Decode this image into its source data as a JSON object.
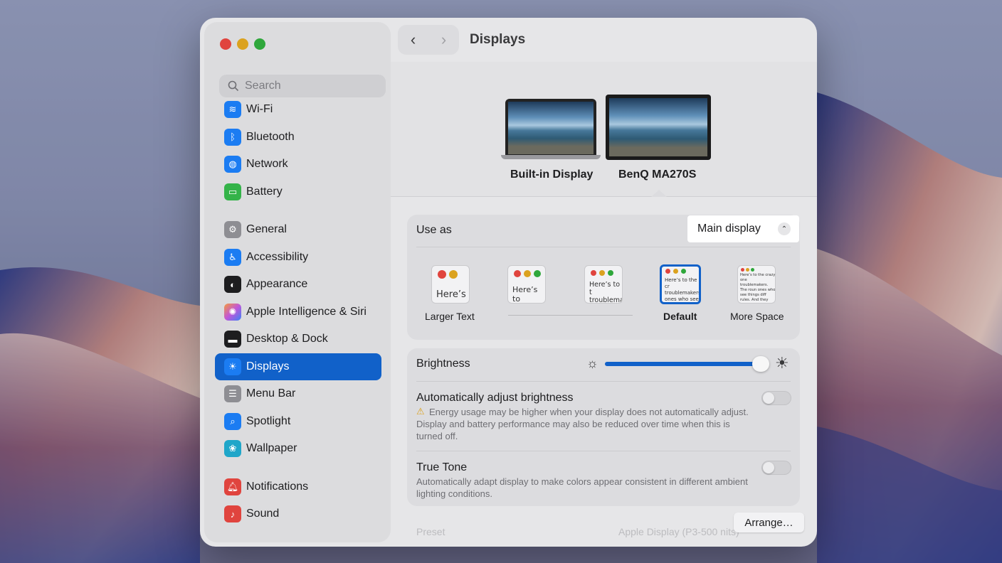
{
  "window": {
    "title": "Displays"
  },
  "search": {
    "placeholder": "Search"
  },
  "sidebar": {
    "items": [
      {
        "label": "Wi-Fi",
        "icon": "wifi-icon",
        "color": "#1b7cf2"
      },
      {
        "label": "Bluetooth",
        "icon": "bluetooth-icon",
        "color": "#1b7cf2"
      },
      {
        "label": "Network",
        "icon": "globe-icon",
        "color": "#1b7cf2"
      },
      {
        "label": "Battery",
        "icon": "battery-icon",
        "color": "#34b349"
      },
      {
        "label": "General",
        "icon": "gear-icon",
        "color": "#8e8e93"
      },
      {
        "label": "Accessibility",
        "icon": "accessibility-icon",
        "color": "#1b7cf2"
      },
      {
        "label": "Appearance",
        "icon": "appearance-icon",
        "color": "#1d1d1f"
      },
      {
        "label": "Apple Intelligence & Siri",
        "icon": "siri-icon",
        "color": "#c056d9"
      },
      {
        "label": "Desktop & Dock",
        "icon": "dock-icon",
        "color": "#1d1d1f"
      },
      {
        "label": "Displays",
        "icon": "sun-icon",
        "color": "#1b7cf2",
        "selected": true
      },
      {
        "label": "Menu Bar",
        "icon": "toggles-icon",
        "color": "#8e8e93"
      },
      {
        "label": "Spotlight",
        "icon": "magnifier-icon",
        "color": "#1b7cf2"
      },
      {
        "label": "Wallpaper",
        "icon": "flower-icon",
        "color": "#1fa6c9"
      },
      {
        "label": "Notifications",
        "icon": "bell-icon",
        "color": "#e0443e"
      },
      {
        "label": "Sound",
        "icon": "speaker-icon",
        "color": "#e0443e"
      }
    ]
  },
  "displays": {
    "builtin": "Built-in Display",
    "external": "BenQ MA270S"
  },
  "use_as": {
    "label": "Use as",
    "value": "Main display"
  },
  "resolution": {
    "options": [
      {
        "label": "Larger Text",
        "sample": "Here’s"
      },
      {
        "label": "",
        "sample": "Here’s to troublem"
      },
      {
        "label": "",
        "sample": "Here’s to t troublema ones who"
      },
      {
        "label": "Default",
        "sample": "Here’s to the cr troublemakers. ones who see t rules. And they"
      },
      {
        "label": "More Space",
        "sample": "Here’s to the crazy one troublemakers. The roun ones who see things diff rules. And they have no can quote them, disagree them. About the only th Because they change th"
      }
    ]
  },
  "brightness": {
    "label": "Brightness",
    "level": 0.96
  },
  "auto_brightness": {
    "label": "Automatically adjust brightness",
    "warning": "Energy usage may be higher when your display does not automatically adjust. Display and battery performance may also be reduced over time when this is turned off.",
    "enabled": false
  },
  "true_tone": {
    "label": "True Tone",
    "description": "Automatically adapt display to make colors appear consistent in different ambient lighting conditions.",
    "enabled": false
  },
  "arrange_button": "Arrange…",
  "preset": {
    "label": "Preset",
    "value": "Apple Display (P3-500 nits)"
  }
}
